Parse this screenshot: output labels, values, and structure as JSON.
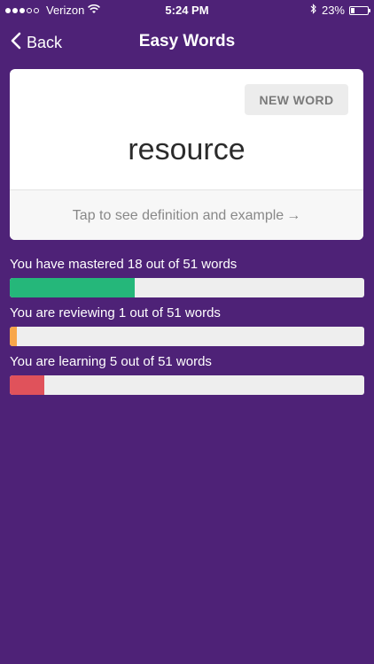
{
  "status_bar": {
    "carrier": "Verizon",
    "time": "5:24 PM",
    "battery_percent": "23%",
    "battery_level": 0.23,
    "signal_bars_filled": 3,
    "signal_bars_total": 5,
    "icons": [
      "wifi-icon",
      "bluetooth-icon",
      "battery-icon"
    ]
  },
  "nav": {
    "back_label": "Back",
    "title": "Easy Words"
  },
  "card": {
    "new_word_label": "NEW WORD",
    "word": "resource",
    "footer_text": "Tap to see definition and example",
    "footer_arrow": "→"
  },
  "progress": [
    {
      "label": "You have mastered 18 out of 51 words",
      "value": 18,
      "total": 51,
      "color": "#25b77a"
    },
    {
      "label": "You are reviewing 1 out of 51 words",
      "value": 1,
      "total": 51,
      "color": "#f8a64a"
    },
    {
      "label": "You are learning 5 out of 51 words",
      "value": 5,
      "total": 51,
      "color": "#e0525b"
    }
  ],
  "colors": {
    "background": "#4e2277",
    "card": "#ffffff"
  }
}
